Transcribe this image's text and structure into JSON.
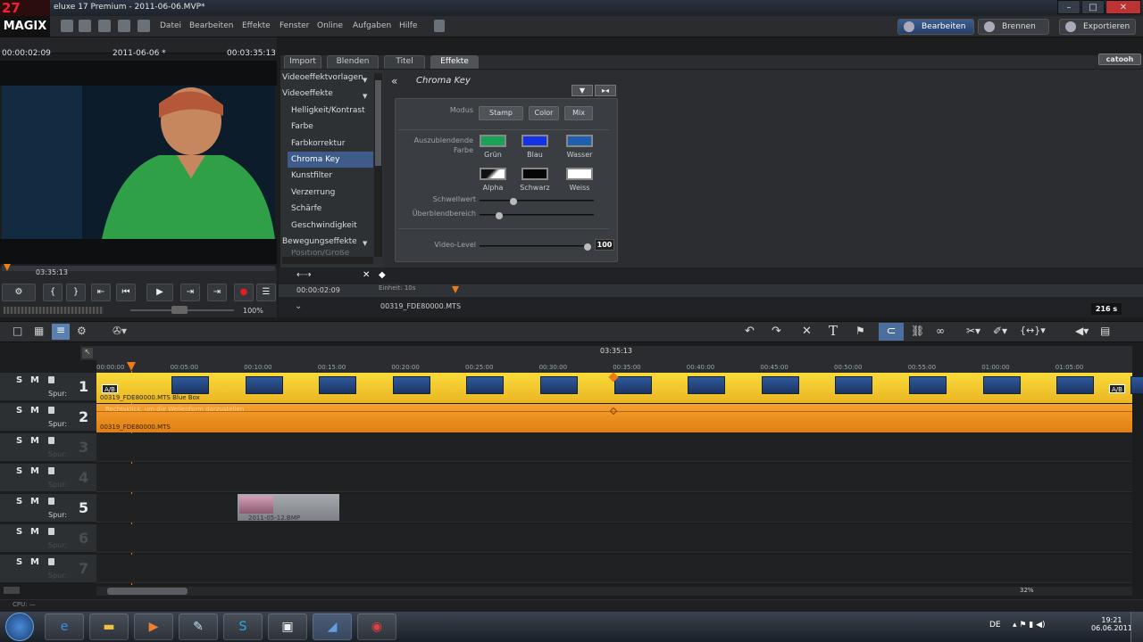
{
  "titlebar": {
    "logo": "27",
    "title": "eluxe 17 Premium - 2011-06-06.MVP*"
  },
  "menubar": {
    "brand": "MAGIX",
    "items": [
      "Datei",
      "Bearbeiten",
      "Effekte",
      "Fenster",
      "Online",
      "Aufgaben",
      "Hilfe"
    ]
  },
  "modes": {
    "edit": "Bearbeiten",
    "burn": "Brennen",
    "export": "Exportieren"
  },
  "preview": {
    "timecode_left": "00:00:02:09",
    "project": "2011-06-06 *",
    "timecode_right": "00:03:35:13",
    "scrub_time": "03:35:13",
    "zoom": "100%"
  },
  "tabs": [
    {
      "label": "Import"
    },
    {
      "label": "Blenden"
    },
    {
      "label": "Titel"
    },
    {
      "label": "Effekte"
    }
  ],
  "brand_right": "catooh",
  "categories": [
    {
      "label": "Videoeffektvorlagen",
      "type": "hdr"
    },
    {
      "label": "Videoeffekte",
      "type": "hdr"
    },
    {
      "label": "Helligkeit/Kontrast"
    },
    {
      "label": "Farbe"
    },
    {
      "label": "Farbkorrektur"
    },
    {
      "label": "Chroma Key",
      "selected": true
    },
    {
      "label": "Kunstfilter"
    },
    {
      "label": "Verzerrung"
    },
    {
      "label": "Schärfe"
    },
    {
      "label": "Geschwindigkeit"
    },
    {
      "label": "Bewegungseffekte",
      "type": "hdr"
    },
    {
      "label": "Position/Größe"
    }
  ],
  "chroma": {
    "title": "Chroma Key",
    "modus_label": "Modus",
    "modus_buttons": [
      "Stamp",
      "Color",
      "Mix"
    ],
    "auszublenden_label": "Auszublendende Farbe",
    "colors": [
      {
        "name": "Grün",
        "color": "#1aa357"
      },
      {
        "name": "Blau",
        "color": "#1533e6"
      },
      {
        "name": "Wasser",
        "color": "#1e5fb0"
      },
      {
        "name": "Alpha",
        "color": "#ffffff"
      },
      {
        "name": "Schwarz",
        "color": "#050505"
      },
      {
        "name": "Weiss",
        "color": "#ffffff"
      }
    ],
    "schwellwert_label": "Schwellwert",
    "schwellwert": 0.3,
    "ueberblend_label": "Überblendbereich",
    "ueberblend": 0.17,
    "videolevel_label": "Video-Level",
    "videolevel": "100"
  },
  "subbar": {
    "time": "00:00:02:09",
    "einheit": "Einheit: 10s",
    "clip": "00319_FDE80000.MTS",
    "duration": "216 s"
  },
  "timeline": {
    "position": "03:35:13",
    "ticks": [
      "00:00:00",
      "00:05:00",
      "00:10:00",
      "00:15:00",
      "00:20:00",
      "00:25:00",
      "00:30:00",
      "00:35:00",
      "00:40:00",
      "00:45:00",
      "00:50:00",
      "00:55:00",
      "01:00:00",
      "01:05:00"
    ],
    "track_labels": {
      "s": "S",
      "m": "M",
      "spur": "Spur:"
    },
    "tracks": [
      "1",
      "2",
      "3",
      "4",
      "5",
      "6",
      "7"
    ],
    "clip1_label": "00319_FDE80000.MTS Blue Box",
    "clip1_tag": "A/B",
    "clip2_note": "Rechtsklick, um die Wellenform darzustellen",
    "clip2_label": "00319_FDE80000.MTS",
    "clip5_label": "2011-05-12.BMP",
    "zoom": "32%"
  },
  "status": {
    "cpu": "CPU: —"
  },
  "taskbar": {
    "lang": "DE",
    "time": "19:21",
    "date": "06.06.2011"
  }
}
